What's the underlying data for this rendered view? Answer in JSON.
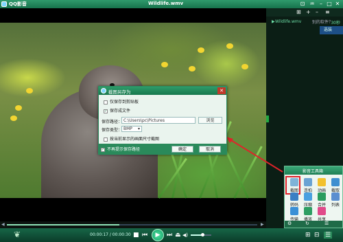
{
  "titlebar": {
    "app_name": "QQ影音",
    "file_name": "Wildlife.wmv",
    "buttons": [
      "⊡",
      "♒",
      "–",
      "□",
      "✕"
    ]
  },
  "playlist": {
    "toolbar_icons": [
      "⊞",
      "+",
      "–",
      "≡"
    ],
    "items": [
      {
        "name": "Wildlife.wmv",
        "duration": "30秒"
      }
    ],
    "bg_hint": "别的软件？",
    "bg_button": "选装"
  },
  "seek": {
    "left_marker": "◀",
    "right_marker": "▶",
    "progress": 0.45
  },
  "controls": {
    "time": "00:00:17 / 00:00:30",
    "volume": 0.55,
    "icons": {
      "stop": "■",
      "prev": "⏮",
      "play": "▶",
      "next": "⏭",
      "eject": "⏏",
      "volume": "◀)"
    },
    "right_icons": [
      "⊞",
      "⊟",
      "☰"
    ]
  },
  "toolbox": {
    "title": "影音工具箱",
    "tools": [
      {
        "label": "截图",
        "color": "#7fb3d8",
        "icon": "screenshot-icon"
      },
      {
        "label": "连拍",
        "color": "#6aa3d3",
        "icon": "burst-icon"
      },
      {
        "label": "动画",
        "color": "#f2c12e",
        "icon": "smiley-icon"
      },
      {
        "label": "截取",
        "color": "#3f8fd0",
        "icon": "clip-icon"
      },
      {
        "label": "转码",
        "color": "#3b7fc4",
        "icon": "convert-icon"
      },
      {
        "label": "压缩",
        "color": "#4aa0e0",
        "icon": "compress-icon"
      },
      {
        "label": "合并",
        "color": "#2a9c5f",
        "icon": "merge-icon"
      },
      {
        "label": "列表",
        "color": "#5b8ed0",
        "icon": "list-icon"
      },
      {
        "label": "传输",
        "color": "#3a90d6",
        "icon": "transfer-icon"
      },
      {
        "label": "播放",
        "color": "#2e9e63",
        "icon": "play-icon"
      },
      {
        "label": "共享",
        "color": "#e04a8a",
        "icon": "share-icon"
      }
    ],
    "footer_icons": [
      "⚙",
      "↻",
      "☰"
    ]
  },
  "dialog": {
    "title": "截图另存为",
    "close": "✕",
    "options": {
      "clipboard_only": "仅保存到剪贴板",
      "save_file": "保存成文件"
    },
    "path_label": "保存路径：",
    "path_value": "C:\\Users\\pc\\Pictures",
    "browse": "浏览",
    "type_label": "保存类型：",
    "type_value": "BMP",
    "current_size": "按当前显示的画面尺寸截图",
    "dont_show": "不再提示保存路径",
    "ok": "确定",
    "cancel": "取消",
    "check": "✓"
  }
}
